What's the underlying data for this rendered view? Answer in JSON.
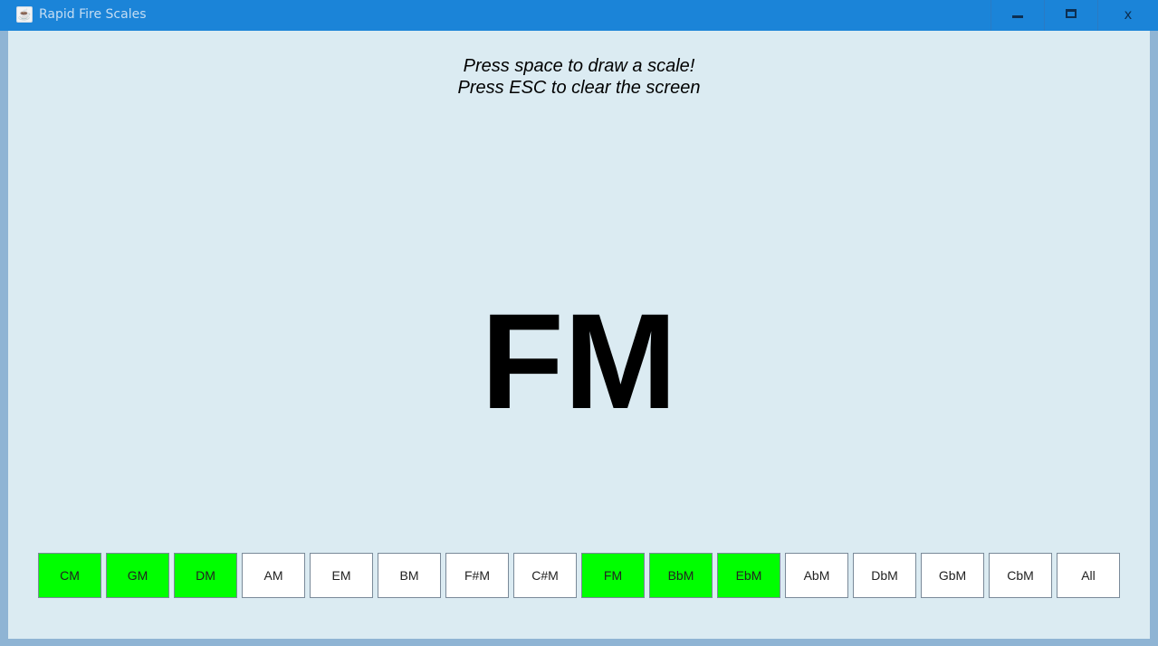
{
  "window": {
    "title": "Rapid Fire Scales",
    "app_icon": "java-cup-icon",
    "controls": {
      "minimize": "minimize-icon",
      "maximize": "maximize-icon",
      "close_label": "x"
    }
  },
  "instructions": {
    "line1": "Press space to draw a scale!",
    "line2": "Press ESC to clear the screen"
  },
  "current_scale": "FM",
  "colors": {
    "selected": "#00ff00",
    "unselected": "#ffffff",
    "background": "#dbebf2",
    "titlebar": "#1b84d8"
  },
  "scale_buttons": [
    {
      "label": "CM",
      "selected": true
    },
    {
      "label": "GM",
      "selected": true
    },
    {
      "label": "DM",
      "selected": true
    },
    {
      "label": "AM",
      "selected": false
    },
    {
      "label": "EM",
      "selected": false
    },
    {
      "label": "BM",
      "selected": false
    },
    {
      "label": "F#M",
      "selected": false
    },
    {
      "label": "C#M",
      "selected": false
    },
    {
      "label": "FM",
      "selected": true
    },
    {
      "label": "BbM",
      "selected": true
    },
    {
      "label": "EbM",
      "selected": true
    },
    {
      "label": "AbM",
      "selected": false
    },
    {
      "label": "DbM",
      "selected": false
    },
    {
      "label": "GbM",
      "selected": false
    },
    {
      "label": "CbM",
      "selected": false
    },
    {
      "label": "All",
      "selected": false
    }
  ]
}
